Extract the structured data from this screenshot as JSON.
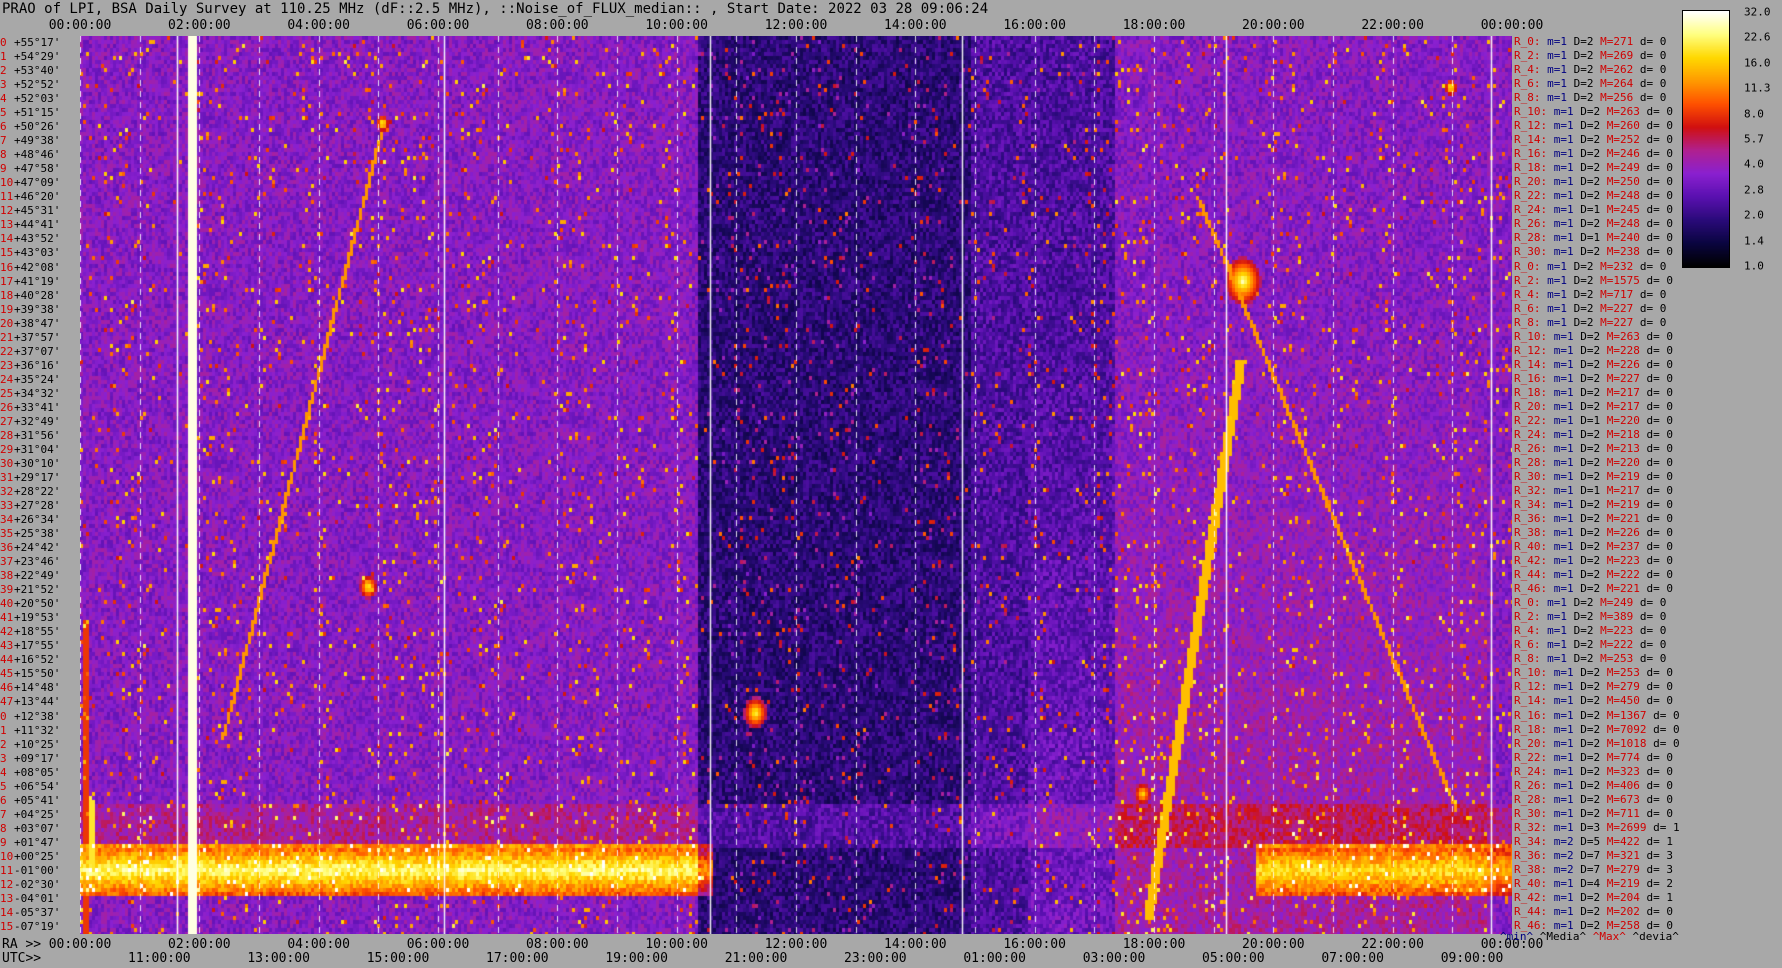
{
  "title": "PRAO of LPI, BSA Daily Survey at 110.25 MHz (dF::2.5 MHz), ::Noise_of_FLUX_median:: , Start Date: 2022 03 28 09:06:24",
  "chart_data": {
    "type": "heatmap",
    "colormap": "gnuplot-like: black-navy-purple-red-orange-yellow-white",
    "x_top_ticks": [
      "00:00:00",
      "02:00:00",
      "04:00:00",
      "06:00:00",
      "08:00:00",
      "10:00:00",
      "12:00:00",
      "14:00:00",
      "16:00:00",
      "18:00:00",
      "20:00:00",
      "22:00:00",
      "00:00:00"
    ],
    "ra_prefix": "RA >>",
    "ra_ticks": [
      "00:00:00",
      "02:00:00",
      "04:00:00",
      "06:00:00",
      "08:00:00",
      "10:00:00",
      "12:00:00",
      "14:00:00",
      "16:00:00",
      "18:00:00",
      "20:00:00",
      "22:00:00",
      "00:00:00"
    ],
    "utc_prefix": "UTC>>",
    "utc_ticks": [
      "11:00:00",
      "13:00:00",
      "15:00:00",
      "17:00:00",
      "19:00:00",
      "21:00:00",
      "23:00:00",
      "01:00:00",
      "03:00:00",
      "05:00:00",
      "07:00:00",
      "09:00:00"
    ],
    "colorbar": {
      "ticks": [
        "32.0",
        "22.6",
        "16.0",
        "11.3",
        "8.0",
        "5.7",
        "4.0",
        "2.8",
        "2.0",
        "1.4",
        "1.0"
      ],
      "colors": [
        "#000000",
        "#0a0540",
        "#2a0a7a",
        "#5a10b0",
        "#8a20d0",
        "#b02090",
        "#d01010",
        "#ff5000",
        "#ff9a00",
        "#ffd800",
        "#ffff80",
        "#ffffff"
      ]
    },
    "declinations": [
      "+55°17'",
      "+54°29'",
      "+53°40'",
      "+52°52'",
      "+52°03'",
      "+51°15'",
      "+50°26'",
      "+49°38'",
      "+48°46'",
      "+47°58'",
      "+47°09'",
      "+46°20'",
      "+45°31'",
      "+44°41'",
      "+43°52'",
      "+43°03'",
      "+42°08'",
      "+41°19'",
      "+40°28'",
      "+39°38'",
      "+38°47'",
      "+37°57'",
      "+37°07'",
      "+36°16'",
      "+35°24'",
      "+34°32'",
      "+33°41'",
      "+32°49'",
      "+31°56'",
      "+31°04'",
      "+30°10'",
      "+29°17'",
      "+28°22'",
      "+27°28'",
      "+26°34'",
      "+25°38'",
      "+24°42'",
      "+23°46'",
      "+22°49'",
      "+21°52'",
      "+20°50'",
      "+19°53'",
      "+18°55'",
      "+17°55'",
      "+16°52'",
      "+15°50'",
      "+14°48'",
      "+13°44'",
      "+12°38'",
      "+11°32'",
      "+10°25'",
      "+09°17'",
      "+08°05'",
      "+06°54'",
      "+05°41'",
      "+04°25'",
      "+03°07'",
      "+01°47'",
      "+00°25'",
      "-01°00'",
      "-02°30'",
      "-04°01'",
      "-05°37'",
      "-07°19'"
    ],
    "decl_index": [
      "0",
      "1",
      "2",
      "3",
      "4",
      "5",
      "6",
      "7",
      "8",
      "9",
      "10",
      "11",
      "12",
      "13",
      "14",
      "15",
      "16",
      "17",
      "18",
      "19",
      "20",
      "21",
      "22",
      "23",
      "24",
      "25",
      "26",
      "27",
      "28",
      "29",
      "30",
      "31",
      "32",
      "33",
      "34",
      "35",
      "36",
      "37",
      "38",
      "39",
      "40",
      "41",
      "42",
      "43",
      "44",
      "45",
      "46",
      "47",
      "0",
      "1",
      "2",
      "3",
      "4",
      "5",
      "6",
      "7",
      "8",
      "9",
      "10",
      "11",
      "12",
      "13",
      "14",
      "15"
    ],
    "stats": [
      {
        "r": "R_0:",
        "m": "m=1",
        "d": "D=2",
        "h": "M=271",
        "dv": "d= 0"
      },
      {
        "r": "R_2:",
        "m": "m=1",
        "d": "D=2",
        "h": "M=269",
        "dv": "d= 0"
      },
      {
        "r": "R_4:",
        "m": "m=1",
        "d": "D=2",
        "h": "M=262",
        "dv": "d= 0"
      },
      {
        "r": "R_6:",
        "m": "m=1",
        "d": "D=2",
        "h": "M=264",
        "dv": "d= 0"
      },
      {
        "r": "R_8:",
        "m": "m=1",
        "d": "D=2",
        "h": "M=256",
        "dv": "d= 0"
      },
      {
        "r": "R_10:",
        "m": "m=1",
        "d": "D=2",
        "h": "M=263",
        "dv": "d= 0"
      },
      {
        "r": "R_12:",
        "m": "m=1",
        "d": "D=2",
        "h": "M=260",
        "dv": "d= 0"
      },
      {
        "r": "R_14:",
        "m": "m=1",
        "d": "D=2",
        "h": "M=252",
        "dv": "d= 0"
      },
      {
        "r": "R_16:",
        "m": "m=1",
        "d": "D=2",
        "h": "M=246",
        "dv": "d= 0"
      },
      {
        "r": "R_18:",
        "m": "m=1",
        "d": "D=2",
        "h": "M=249",
        "dv": "d= 0"
      },
      {
        "r": "R_20:",
        "m": "m=1",
        "d": "D=2",
        "h": "M=250",
        "dv": "d= 0"
      },
      {
        "r": "R_22:",
        "m": "m=1",
        "d": "D=2",
        "h": "M=248",
        "dv": "d= 0"
      },
      {
        "r": "R_24:",
        "m": "m=1",
        "d": "D=1",
        "h": "M=245",
        "dv": "d= 0"
      },
      {
        "r": "R_26:",
        "m": "m=1",
        "d": "D=2",
        "h": "M=248",
        "dv": "d= 0"
      },
      {
        "r": "R_28:",
        "m": "m=1",
        "d": "D=1",
        "h": "M=240",
        "dv": "d= 0"
      },
      {
        "r": "R_30:",
        "m": "m=1",
        "d": "D=2",
        "h": "M=238",
        "dv": "d= 0"
      },
      {
        "r": "R_0:",
        "m": "m=1",
        "d": "D=2",
        "h": "M=232",
        "dv": "d= 0"
      },
      {
        "r": "R_2:",
        "m": "m=1",
        "d": "D=2",
        "h": "M=1575",
        "dv": "d= 0"
      },
      {
        "r": "R_4:",
        "m": "m=1",
        "d": "D=2",
        "h": "M=717",
        "dv": "d= 0"
      },
      {
        "r": "R_6:",
        "m": "m=1",
        "d": "D=2",
        "h": "M=227",
        "dv": "d= 0"
      },
      {
        "r": "R_8:",
        "m": "m=1",
        "d": "D=2",
        "h": "M=227",
        "dv": "d= 0"
      },
      {
        "r": "R_10:",
        "m": "m=1",
        "d": "D=2",
        "h": "M=263",
        "dv": "d= 0"
      },
      {
        "r": "R_12:",
        "m": "m=1",
        "d": "D=2",
        "h": "M=228",
        "dv": "d= 0"
      },
      {
        "r": "R_14:",
        "m": "m=1",
        "d": "D=2",
        "h": "M=226",
        "dv": "d= 0"
      },
      {
        "r": "R_16:",
        "m": "m=1",
        "d": "D=2",
        "h": "M=227",
        "dv": "d= 0"
      },
      {
        "r": "R_18:",
        "m": "m=1",
        "d": "D=2",
        "h": "M=217",
        "dv": "d= 0"
      },
      {
        "r": "R_20:",
        "m": "m=1",
        "d": "D=2",
        "h": "M=217",
        "dv": "d= 0"
      },
      {
        "r": "R_22:",
        "m": "m=1",
        "d": "D=1",
        "h": "M=220",
        "dv": "d= 0"
      },
      {
        "r": "R_24:",
        "m": "m=1",
        "d": "D=2",
        "h": "M=218",
        "dv": "d= 0"
      },
      {
        "r": "R_26:",
        "m": "m=1",
        "d": "D=2",
        "h": "M=213",
        "dv": "d= 0"
      },
      {
        "r": "R_28:",
        "m": "m=1",
        "d": "D=2",
        "h": "M=220",
        "dv": "d= 0"
      },
      {
        "r": "R_30:",
        "m": "m=1",
        "d": "D=2",
        "h": "M=219",
        "dv": "d= 0"
      },
      {
        "r": "R_32:",
        "m": "m=1",
        "d": "D=1",
        "h": "M=217",
        "dv": "d= 0"
      },
      {
        "r": "R_34:",
        "m": "m=1",
        "d": "D=2",
        "h": "M=219",
        "dv": "d= 0"
      },
      {
        "r": "R_36:",
        "m": "m=1",
        "d": "D=2",
        "h": "M=221",
        "dv": "d= 0"
      },
      {
        "r": "R_38:",
        "m": "m=1",
        "d": "D=2",
        "h": "M=226",
        "dv": "d= 0"
      },
      {
        "r": "R_40:",
        "m": "m=1",
        "d": "D=2",
        "h": "M=237",
        "dv": "d= 0"
      },
      {
        "r": "R_42:",
        "m": "m=1",
        "d": "D=2",
        "h": "M=223",
        "dv": "d= 0"
      },
      {
        "r": "R_44:",
        "m": "m=1",
        "d": "D=2",
        "h": "M=222",
        "dv": "d= 0"
      },
      {
        "r": "R_46:",
        "m": "m=1",
        "d": "D=2",
        "h": "M=221",
        "dv": "d= 0"
      },
      {
        "r": "R_0:",
        "m": "m=1",
        "d": "D=2",
        "h": "M=249",
        "dv": "d= 0"
      },
      {
        "r": "R_2:",
        "m": "m=1",
        "d": "D=2",
        "h": "M=389",
        "dv": "d= 0"
      },
      {
        "r": "R_4:",
        "m": "m=1",
        "d": "D=2",
        "h": "M=223",
        "dv": "d= 0"
      },
      {
        "r": "R_6:",
        "m": "m=1",
        "d": "D=2",
        "h": "M=222",
        "dv": "d= 0"
      },
      {
        "r": "R_8:",
        "m": "m=1",
        "d": "D=2",
        "h": "M=253",
        "dv": "d= 0"
      },
      {
        "r": "R_10:",
        "m": "m=1",
        "d": "D=2",
        "h": "M=253",
        "dv": "d= 0"
      },
      {
        "r": "R_12:",
        "m": "m=1",
        "d": "D=2",
        "h": "M=279",
        "dv": "d= 0"
      },
      {
        "r": "R_14:",
        "m": "m=1",
        "d": "D=2",
        "h": "M=450",
        "dv": "d= 0"
      },
      {
        "r": "R_16:",
        "m": "m=1",
        "d": "D=2",
        "h": "M=1367",
        "dv": "d= 0"
      },
      {
        "r": "R_18:",
        "m": "m=1",
        "d": "D=2",
        "h": "M=7092",
        "dv": "d= 0"
      },
      {
        "r": "R_20:",
        "m": "m=1",
        "d": "D=2",
        "h": "M=1018",
        "dv": "d= 0"
      },
      {
        "r": "R_22:",
        "m": "m=1",
        "d": "D=2",
        "h": "M=774",
        "dv": "d= 0"
      },
      {
        "r": "R_24:",
        "m": "m=1",
        "d": "D=2",
        "h": "M=323",
        "dv": "d= 0"
      },
      {
        "r": "R_26:",
        "m": "m=1",
        "d": "D=2",
        "h": "M=406",
        "dv": "d= 0"
      },
      {
        "r": "R_28:",
        "m": "m=1",
        "d": "D=2",
        "h": "M=673",
        "dv": "d= 0"
      },
      {
        "r": "R_30:",
        "m": "m=1",
        "d": "D=2",
        "h": "M=711",
        "dv": "d= 0"
      },
      {
        "r": "R_32:",
        "m": "m=1",
        "d": "D=3",
        "h": "M=2699",
        "dv": "d= 1"
      },
      {
        "r": "R_34:",
        "m": "m=2",
        "d": "D=5",
        "h": "M=422",
        "dv": "d= 1"
      },
      {
        "r": "R_36:",
        "m": "m=2",
        "d": "D=7",
        "h": "M=321",
        "dv": "d= 3"
      },
      {
        "r": "R_38:",
        "m": "m=2",
        "d": "D=7",
        "h": "M=279",
        "dv": "d= 3"
      },
      {
        "r": "R_40:",
        "m": "m=1",
        "d": "D=4",
        "h": "M=219",
        "dv": "d= 2"
      },
      {
        "r": "R_42:",
        "m": "m=1",
        "d": "D=2",
        "h": "M=204",
        "dv": "d= 1"
      },
      {
        "r": "R_44:",
        "m": "m=1",
        "d": "D=2",
        "h": "M=202",
        "dv": "d= 0"
      },
      {
        "r": "R_46:",
        "m": "m=1",
        "d": "D=2",
        "h": "M=258",
        "dv": "d= 0"
      }
    ],
    "footer": {
      "min": "^min^",
      "median": "^Media^",
      "max": "^Max^",
      "dev": "^devia^"
    }
  }
}
